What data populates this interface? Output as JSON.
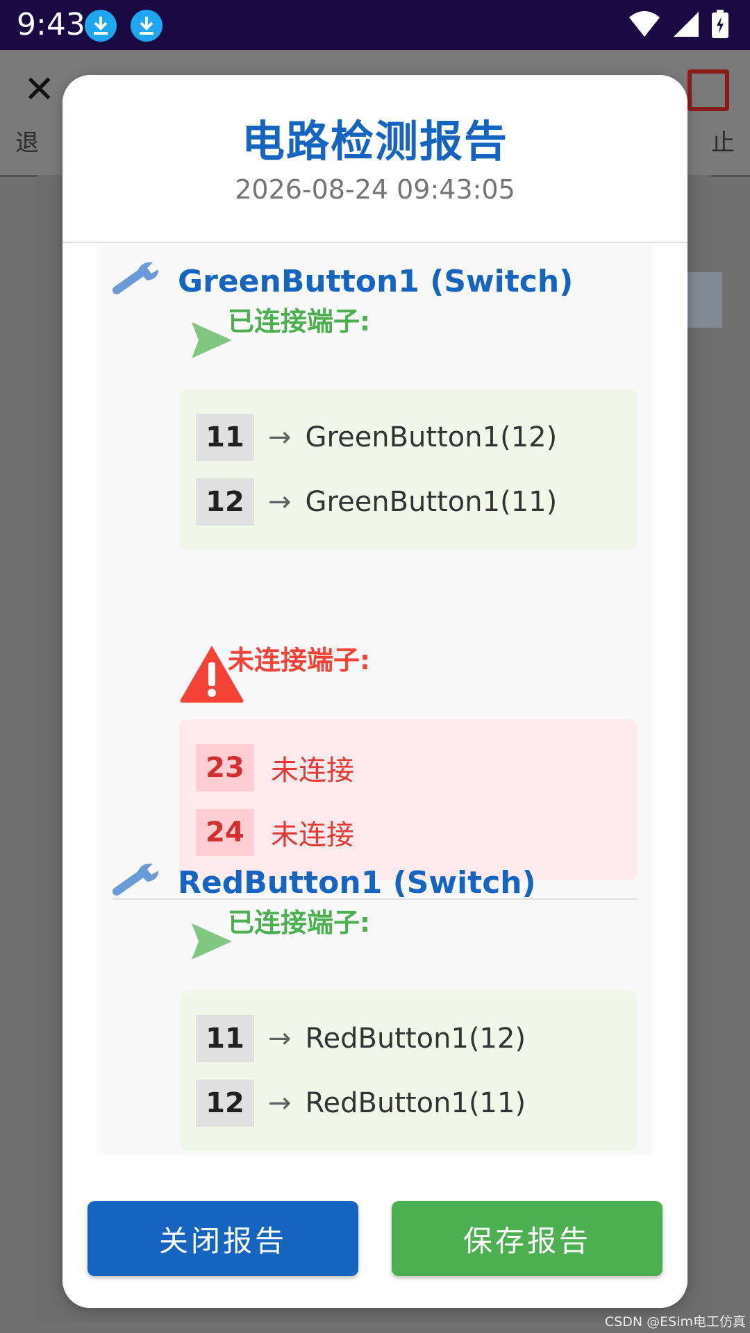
{
  "status_bar": {
    "time": "9:43"
  },
  "background": {
    "left_label": "退",
    "right_label": "止"
  },
  "dialog": {
    "title": "电路检测报告",
    "date": "2026-08-24 09:43:05",
    "components": [
      {
        "name": "GreenButton1 (Switch)",
        "connected_title": "已连接端子:",
        "connected": [
          {
            "pin": "11",
            "arrow": "→",
            "target": "GreenButton1(12)"
          },
          {
            "pin": "12",
            "arrow": "→",
            "target": "GreenButton1(11)"
          }
        ],
        "unconnected_title": "未连接端子:",
        "unconnected": [
          {
            "pin": "23",
            "status": "未连接"
          },
          {
            "pin": "24",
            "status": "未连接"
          }
        ]
      },
      {
        "name": "RedButton1 (Switch)",
        "connected_title": "已连接端子:",
        "connected": [
          {
            "pin": "11",
            "arrow": "→",
            "target": "RedButton1(12)"
          },
          {
            "pin": "12",
            "arrow": "→",
            "target": "RedButton1(11)"
          }
        ]
      }
    ],
    "buttons": {
      "close": "关闭报告",
      "save": "保存报告"
    }
  },
  "watermark": "CSDN @ESim电工仿真",
  "colors": {
    "primary": "#1565c0",
    "success": "#4caf50",
    "danger": "#f44336",
    "status_bar": "#1a0a44"
  }
}
